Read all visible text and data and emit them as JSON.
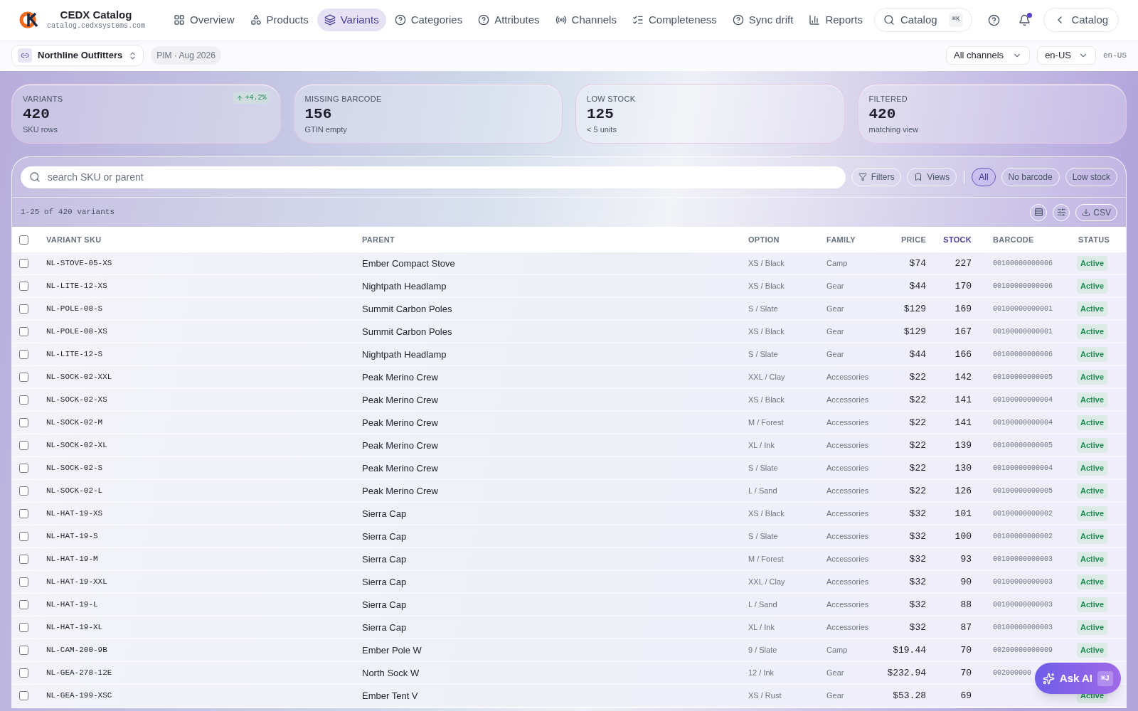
{
  "brand": {
    "name": "CEDX Catalog",
    "domain": "catalog.cedxsystems.com"
  },
  "nav": [
    {
      "label": "Overview",
      "selected": false
    },
    {
      "label": "Products",
      "selected": false
    },
    {
      "label": "Variants",
      "selected": true
    },
    {
      "label": "Categories",
      "selected": false
    },
    {
      "label": "Attributes",
      "selected": false
    },
    {
      "label": "Channels",
      "selected": false
    },
    {
      "label": "Completeness",
      "selected": false
    },
    {
      "label": "Sync drift",
      "selected": false
    },
    {
      "label": "Reports",
      "selected": false
    }
  ],
  "search": {
    "label": "Catalog",
    "shortcut": "⌘K"
  },
  "notifications": {
    "unread": true
  },
  "back": {
    "label": "Catalog"
  },
  "workspace": {
    "name": "Northline Outfitters",
    "period": "PIM · Aug 2026"
  },
  "channel_select": "All channels",
  "locale_select": "en-US",
  "locale_label": "en-US",
  "kpis": [
    {
      "label": "VARIANTS",
      "value": "420",
      "sub": "SKU rows",
      "delta": "+4.2%"
    },
    {
      "label": "MISSING BARCODE",
      "value": "156",
      "sub": "GTIN empty"
    },
    {
      "label": "LOW STOCK",
      "value": "125",
      "sub": "< 5 units"
    },
    {
      "label": "FILTERED",
      "value": "420",
      "sub": "matching view"
    }
  ],
  "table_search": {
    "placeholder": "search SKU or parent"
  },
  "tools": [
    "Filters",
    "Views"
  ],
  "chips": [
    {
      "label": "All",
      "selected": true
    },
    {
      "label": "No barcode",
      "selected": false
    },
    {
      "label": "Low stock",
      "selected": false
    }
  ],
  "range": "1-25 of 420 variants",
  "export": "CSV",
  "table": {
    "select_all": false,
    "columns": [
      {
        "label": "VARIANT SKU",
        "sorted": false
      },
      {
        "label": "PARENT",
        "sorted": false
      },
      {
        "label": "OPTION",
        "sorted": false
      },
      {
        "label": "FAMILY",
        "sorted": false
      },
      {
        "label": "PRICE",
        "sorted": false
      },
      {
        "label": "STOCK",
        "sorted": true
      },
      {
        "label": "BARCODE",
        "sorted": false
      },
      {
        "label": "STATUS",
        "sorted": false
      }
    ],
    "rows": [
      {
        "checked": false,
        "sku": "NL-STOVE-05-XS",
        "parent": "Ember Compact Stove",
        "option": "XS / Black",
        "family": "Camp",
        "price": "$74",
        "stock": "227",
        "barcode": "00100000000006",
        "status": "Active"
      },
      {
        "checked": false,
        "sku": "NL-LITE-12-XS",
        "parent": "Nightpath Headlamp",
        "option": "XS / Black",
        "family": "Gear",
        "price": "$44",
        "stock": "170",
        "barcode": "00100000000006",
        "status": "Active"
      },
      {
        "checked": false,
        "sku": "NL-POLE-08-S",
        "parent": "Summit Carbon Poles",
        "option": "S / Slate",
        "family": "Gear",
        "price": "$129",
        "stock": "169",
        "barcode": "00100000000001",
        "status": "Active"
      },
      {
        "checked": false,
        "sku": "NL-POLE-08-XS",
        "parent": "Summit Carbon Poles",
        "option": "XS / Black",
        "family": "Gear",
        "price": "$129",
        "stock": "167",
        "barcode": "00100000000001",
        "status": "Active"
      },
      {
        "checked": false,
        "sku": "NL-LITE-12-S",
        "parent": "Nightpath Headlamp",
        "option": "S / Slate",
        "family": "Gear",
        "price": "$44",
        "stock": "166",
        "barcode": "00100000000006",
        "status": "Active"
      },
      {
        "checked": false,
        "sku": "NL-SOCK-02-XXL",
        "parent": "Peak Merino Crew",
        "option": "XXL / Clay",
        "family": "Accessories",
        "price": "$22",
        "stock": "142",
        "barcode": "00100000000005",
        "status": "Active"
      },
      {
        "checked": false,
        "sku": "NL-SOCK-02-XS",
        "parent": "Peak Merino Crew",
        "option": "XS / Black",
        "family": "Accessories",
        "price": "$22",
        "stock": "141",
        "barcode": "00100000000004",
        "status": "Active"
      },
      {
        "checked": false,
        "sku": "NL-SOCK-02-M",
        "parent": "Peak Merino Crew",
        "option": "M / Forest",
        "family": "Accessories",
        "price": "$22",
        "stock": "141",
        "barcode": "00100000000004",
        "status": "Active"
      },
      {
        "checked": false,
        "sku": "NL-SOCK-02-XL",
        "parent": "Peak Merino Crew",
        "option": "XL / Ink",
        "family": "Accessories",
        "price": "$22",
        "stock": "139",
        "barcode": "00100000000005",
        "status": "Active"
      },
      {
        "checked": false,
        "sku": "NL-SOCK-02-S",
        "parent": "Peak Merino Crew",
        "option": "S / Slate",
        "family": "Accessories",
        "price": "$22",
        "stock": "130",
        "barcode": "00100000000004",
        "status": "Active"
      },
      {
        "checked": false,
        "sku": "NL-SOCK-02-L",
        "parent": "Peak Merino Crew",
        "option": "L / Sand",
        "family": "Accessories",
        "price": "$22",
        "stock": "126",
        "barcode": "00100000000005",
        "status": "Active"
      },
      {
        "checked": false,
        "sku": "NL-HAT-19-XS",
        "parent": "Sierra Cap",
        "option": "XS / Black",
        "family": "Accessories",
        "price": "$32",
        "stock": "101",
        "barcode": "00100000000002",
        "status": "Active"
      },
      {
        "checked": false,
        "sku": "NL-HAT-19-S",
        "parent": "Sierra Cap",
        "option": "S / Slate",
        "family": "Accessories",
        "price": "$32",
        "stock": "100",
        "barcode": "00100000000002",
        "status": "Active"
      },
      {
        "checked": false,
        "sku": "NL-HAT-19-M",
        "parent": "Sierra Cap",
        "option": "M / Forest",
        "family": "Accessories",
        "price": "$32",
        "stock": "93",
        "barcode": "00100000000003",
        "status": "Active"
      },
      {
        "checked": false,
        "sku": "NL-HAT-19-XXL",
        "parent": "Sierra Cap",
        "option": "XXL / Clay",
        "family": "Accessories",
        "price": "$32",
        "stock": "90",
        "barcode": "00100000000003",
        "status": "Active"
      },
      {
        "checked": false,
        "sku": "NL-HAT-19-L",
        "parent": "Sierra Cap",
        "option": "L / Sand",
        "family": "Accessories",
        "price": "$32",
        "stock": "88",
        "barcode": "00100000000003",
        "status": "Active"
      },
      {
        "checked": false,
        "sku": "NL-HAT-19-XL",
        "parent": "Sierra Cap",
        "option": "XL / Ink",
        "family": "Accessories",
        "price": "$32",
        "stock": "87",
        "barcode": "00100000000003",
        "status": "Active"
      },
      {
        "checked": false,
        "sku": "NL-CAM-200-9B",
        "parent": "Ember Pole W",
        "option": "9 / Slate",
        "family": "Camp",
        "price": "$19.44",
        "stock": "70",
        "barcode": "00200000000009",
        "status": "Active"
      },
      {
        "checked": false,
        "sku": "NL-GEA-278-12E",
        "parent": "North Sock W",
        "option": "12 / Ink",
        "family": "Gear",
        "price": "$232.94",
        "stock": "70",
        "barcode": "002000000"
      },
      {
        "checked": false,
        "sku": "NL-GEA-199-XSC",
        "parent": "Ember Tent V",
        "option": "XS / Rust",
        "family": "Gear",
        "price": "$53.28",
        "stock": "69",
        "status": "Active"
      }
    ]
  },
  "ask_ai": {
    "label": "Ask AI",
    "shortcut": "⌘J"
  }
}
